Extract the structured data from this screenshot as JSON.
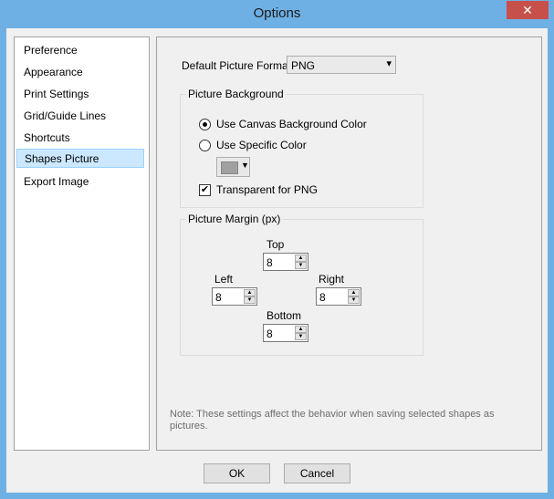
{
  "window": {
    "title": "Options",
    "close_glyph": "✕"
  },
  "nav": {
    "items": [
      {
        "label": "Preference"
      },
      {
        "label": "Appearance"
      },
      {
        "label": "Print Settings"
      },
      {
        "label": "Grid/Guide Lines"
      },
      {
        "label": "Shortcuts"
      },
      {
        "label": "Shapes Picture",
        "selected": true
      },
      {
        "label": "Export Image"
      }
    ]
  },
  "panel": {
    "format_label": "Default Picture Format",
    "format_value": "PNG",
    "background": {
      "title": "Picture Background",
      "use_canvas_label": "Use Canvas Background Color",
      "use_specific_label": "Use Specific Color",
      "selected_option": "use_canvas",
      "swatch_color": "#a0a0a0",
      "transparent_label": "Transparent for PNG",
      "transparent_checked": true,
      "check_glyph": "✔"
    },
    "margin": {
      "title": "Picture Margin (px)",
      "top_label": "Top",
      "top_value": "8",
      "left_label": "Left",
      "left_value": "8",
      "right_label": "Right",
      "right_value": "8",
      "bottom_label": "Bottom",
      "bottom_value": "8"
    },
    "note": "Note: These settings affect the behavior when saving selected shapes as pictures."
  },
  "buttons": {
    "ok": "OK",
    "cancel": "Cancel"
  },
  "icons": {
    "dropdown": "▾",
    "spin_up": "▲",
    "spin_down": "▼"
  },
  "colors": {
    "titlebar": "#6fb0e4",
    "close": "#c7504a",
    "selection": "#cce8ff"
  }
}
